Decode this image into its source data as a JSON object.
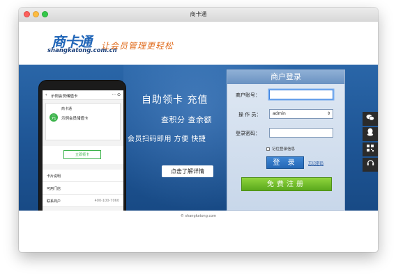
{
  "window": {
    "title": "商卡通"
  },
  "header": {
    "logo_text": "商卡通",
    "logo_url": "shangkatong.com.cn",
    "slogan": "让会员管理更轻松"
  },
  "phone": {
    "nav_back": "‹",
    "nav_title": "示例会员储值卡",
    "nav_actions": "··· ⊙",
    "brand": "商卡通",
    "avatar": "元",
    "card_name": "示例会员储值卡",
    "button": "立即领卡",
    "rows": [
      {
        "key": "卡片说明",
        "value": ""
      },
      {
        "key": "可用门店",
        "value": ""
      },
      {
        "key": "联系商户",
        "value": "400-100-7060"
      }
    ]
  },
  "hero": {
    "line1": "自助领卡 充值",
    "line2": "查积分 查余额",
    "line3": "会员扫码即用 方便 快捷",
    "detail_button": "点击了解详情"
  },
  "login": {
    "heading": "商户登录",
    "account_label": "商户账号：",
    "account_value": "",
    "operator_label": "操 作 员：",
    "operator_value": "admin",
    "password_label": "登录密码：",
    "password_value": "",
    "remember_label": "记住登录信息",
    "login_button": "登 录",
    "forgot_link": "忘记密码",
    "register_button": "免费注册"
  },
  "side_icons": [
    "wechat-icon",
    "qq-icon",
    "qrcode-icon",
    "headset-icon"
  ],
  "footer": {
    "copyright": "© shangkatong.com"
  },
  "colors": {
    "banner_blue": "#1e5595",
    "logo_blue": "#2166b8",
    "slogan_orange": "#e06b1c",
    "register_green": "#5aa81d",
    "login_blue": "#2468b5"
  }
}
